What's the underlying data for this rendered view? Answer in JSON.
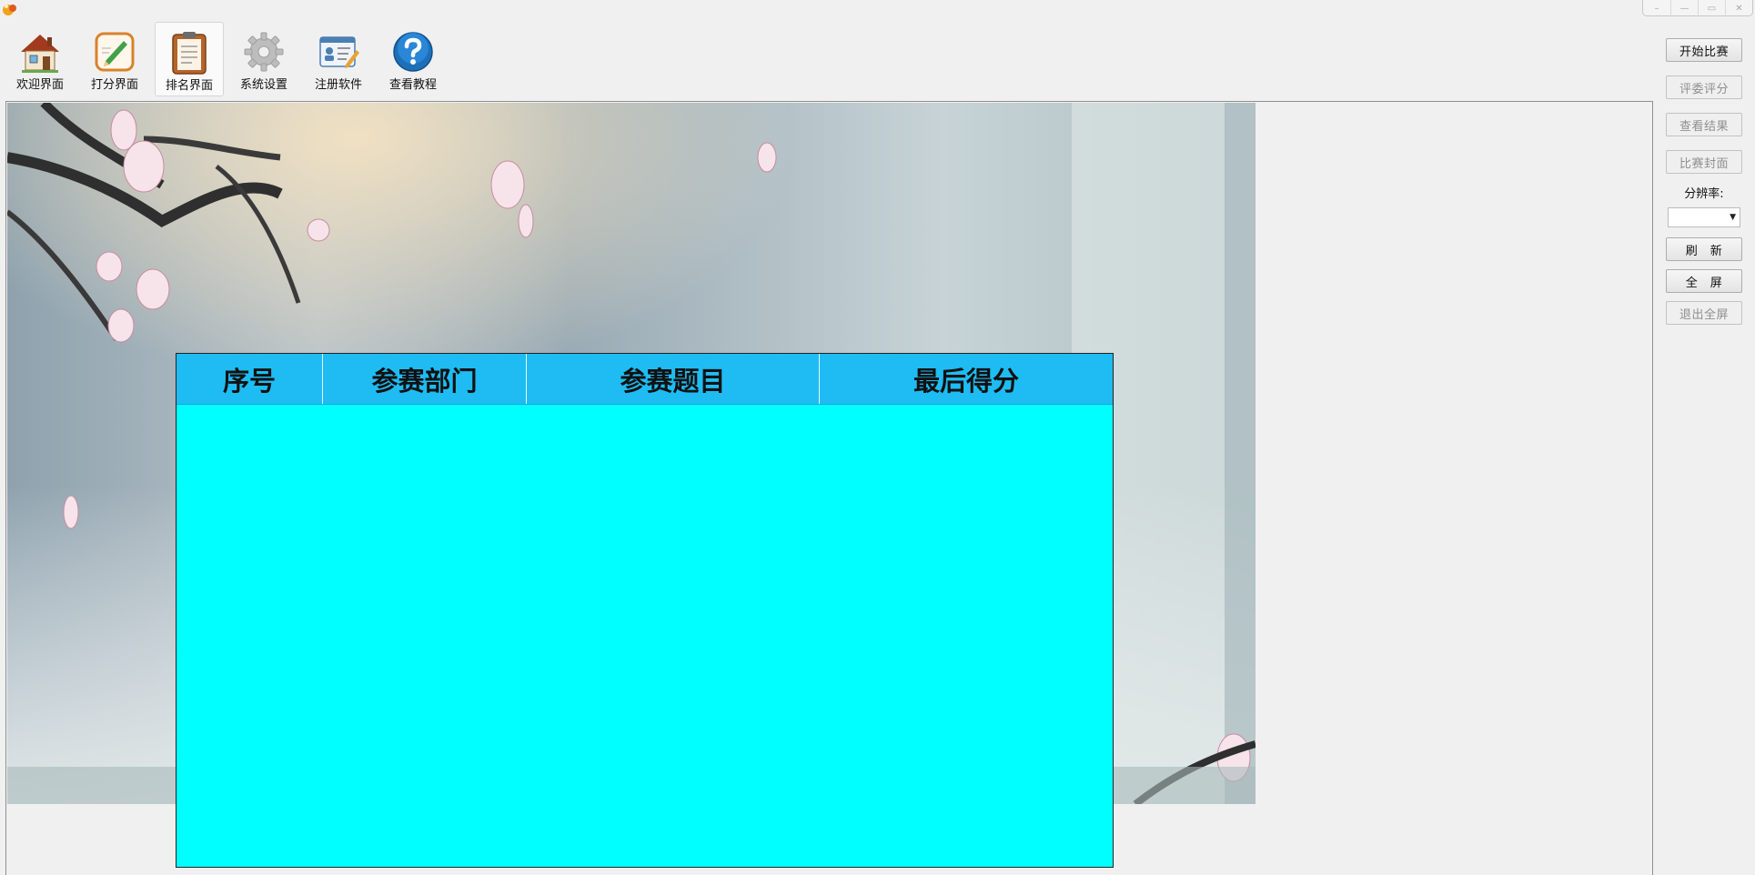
{
  "window": {
    "controls": [
      "–",
      "—",
      "▭",
      "✕"
    ]
  },
  "toolbar": {
    "items": [
      {
        "label": "欢迎界面",
        "icon": "house-icon",
        "active": false
      },
      {
        "label": "打分界面",
        "icon": "score-pencil-icon",
        "active": false
      },
      {
        "label": "排名界面",
        "icon": "clipboard-icon",
        "active": true
      },
      {
        "label": "系统设置",
        "icon": "gear-icon",
        "active": false
      },
      {
        "label": "注册软件",
        "icon": "register-card-icon",
        "active": false
      },
      {
        "label": "查看教程",
        "icon": "help-icon",
        "active": false
      }
    ]
  },
  "ranking_table": {
    "columns": [
      "序号",
      "参赛部门",
      "参赛题目",
      "最后得分"
    ],
    "rows": []
  },
  "side_panel": {
    "start_match": "开始比赛",
    "judge_scoring": "评委评分",
    "view_results": "查看结果",
    "match_cover": "比赛封面",
    "resolution_label": "分辨率:",
    "resolution_value": "",
    "refresh": "刷　新",
    "fullscreen": "全　屏",
    "exit_fullscreen": "退出全屏"
  },
  "colors": {
    "table_header": "#1ebcf3",
    "table_body": "#00ffff",
    "window_bg": "#f0f0f0"
  }
}
